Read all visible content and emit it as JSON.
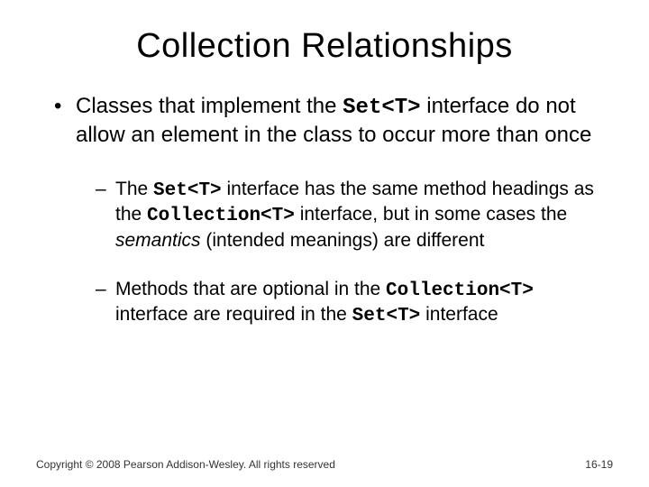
{
  "title": "Collection Relationships",
  "bullet1": {
    "pre": "Classes that implement the ",
    "code": "Set<T>",
    "post": " interface do not allow an element in the class to occur more than once"
  },
  "sub1": {
    "a": "The ",
    "code1": "Set<T>",
    "b": " interface has the same method headings as the ",
    "code2": "Collection<T>",
    "c": " interface, but in some cases the ",
    "em": "semantics",
    "d": " (intended meanings) are different"
  },
  "sub2": {
    "a": "Methods that are optional in the ",
    "code1": "Collection<T>",
    "b": " interface are required in the ",
    "code2": "Set<T>",
    "c": " interface"
  },
  "footer": {
    "copyright": "Copyright © 2008 Pearson Addison-Wesley. All rights reserved",
    "page": "16-19"
  }
}
